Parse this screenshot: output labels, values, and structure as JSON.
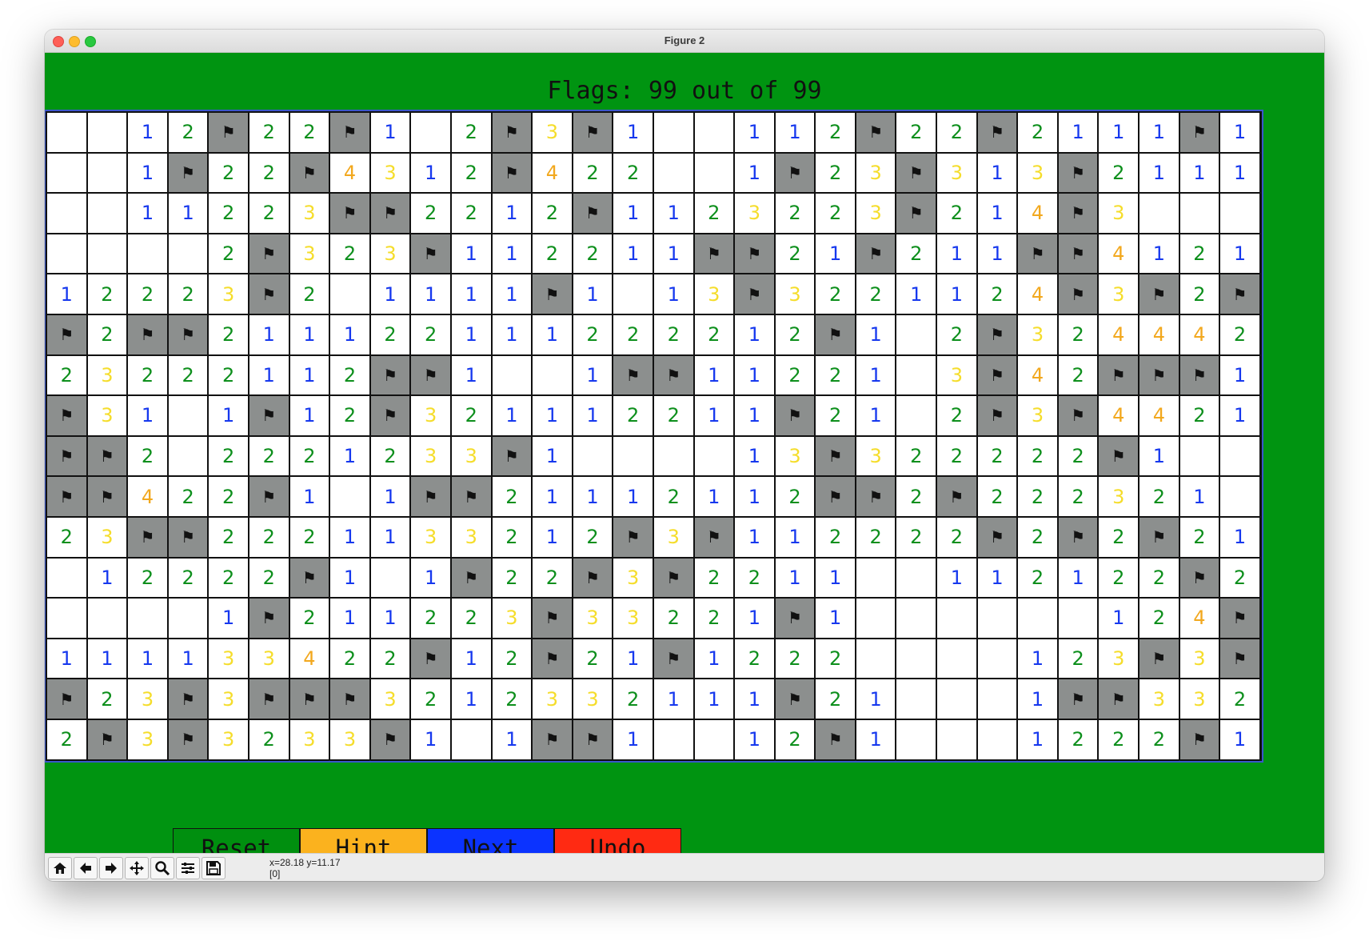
{
  "window": {
    "title": "Figure 2"
  },
  "header": {
    "flags_text": "Flags: 99 out of 99"
  },
  "board": {
    "rows": 16,
    "cols": 30,
    "cells": [
      [
        "",
        "",
        "1",
        "2",
        "F",
        "2",
        "2",
        "F",
        "1",
        "",
        "2",
        "F",
        "3",
        "F",
        "1",
        "",
        "",
        "1",
        "1",
        "2",
        "F",
        "2",
        "2",
        "F",
        "2",
        "1",
        "1",
        "1",
        "F",
        "1"
      ],
      [
        "",
        "",
        "1",
        "F",
        "2",
        "2",
        "F",
        "4",
        "3",
        "1",
        "2",
        "F",
        "4",
        "2",
        "2",
        "",
        "",
        "1",
        "F",
        "2",
        "3",
        "F",
        "3",
        "1",
        "3",
        "F",
        "2",
        "1",
        "1",
        "1"
      ],
      [
        "",
        "",
        "1",
        "1",
        "2",
        "2",
        "3",
        "F",
        "F",
        "2",
        "2",
        "1",
        "2",
        "F",
        "1",
        "1",
        "2",
        "3",
        "2",
        "2",
        "3",
        "F",
        "2",
        "1",
        "4",
        "F",
        "3",
        "",
        "",
        ""
      ],
      [
        "",
        "",
        "",
        "",
        "2",
        "F",
        "3",
        "2",
        "3",
        "F",
        "1",
        "1",
        "2",
        "2",
        "1",
        "1",
        "F",
        "F",
        "2",
        "1",
        "F",
        "2",
        "1",
        "1",
        "F",
        "F",
        "4",
        "1",
        "2",
        "1"
      ],
      [
        "1",
        "2",
        "2",
        "2",
        "3",
        "F",
        "2",
        "",
        "1",
        "1",
        "1",
        "1",
        "F",
        "1",
        "",
        "1",
        "3",
        "F",
        "3",
        "2",
        "2",
        "1",
        "1",
        "2",
        "4",
        "F",
        "3",
        "F",
        "2",
        "F"
      ],
      [
        "F",
        "2",
        "F",
        "F",
        "2",
        "1",
        "1",
        "1",
        "2",
        "2",
        "1",
        "1",
        "1",
        "2",
        "2",
        "2",
        "2",
        "1",
        "2",
        "F",
        "1",
        "",
        "2",
        "F",
        "3",
        "2",
        "4",
        "4",
        "4",
        "2"
      ],
      [
        "2",
        "3",
        "2",
        "2",
        "2",
        "1",
        "1",
        "2",
        "F",
        "F",
        "1",
        "",
        "",
        "1",
        "F",
        "F",
        "1",
        "1",
        "2",
        "2",
        "1",
        "",
        "3",
        "F",
        "4",
        "2",
        "F",
        "F",
        "F",
        "1"
      ],
      [
        "F",
        "3",
        "1",
        "",
        "1",
        "F",
        "1",
        "2",
        "F",
        "3",
        "2",
        "1",
        "1",
        "1",
        "2",
        "2",
        "1",
        "1",
        "F",
        "2",
        "1",
        "",
        "2",
        "F",
        "3",
        "F",
        "4",
        "4",
        "2",
        "1"
      ],
      [
        "F",
        "F",
        "2",
        "",
        "2",
        "2",
        "2",
        "1",
        "2",
        "3",
        "3",
        "F",
        "1",
        "",
        "",
        "",
        "",
        "1",
        "3",
        "F",
        "3",
        "2",
        "2",
        "2",
        "2",
        "2",
        "F",
        "1",
        "",
        ""
      ],
      [
        "F",
        "F",
        "4",
        "2",
        "2",
        "F",
        "1",
        "",
        "1",
        "F",
        "F",
        "2",
        "1",
        "1",
        "1",
        "2",
        "1",
        "1",
        "2",
        "F",
        "F",
        "2",
        "F",
        "2",
        "2",
        "2",
        "3",
        "2",
        "1",
        ""
      ],
      [
        "2",
        "3",
        "F",
        "F",
        "2",
        "2",
        "2",
        "1",
        "1",
        "3",
        "3",
        "2",
        "1",
        "2",
        "F",
        "3",
        "F",
        "1",
        "1",
        "2",
        "2",
        "2",
        "2",
        "F",
        "2",
        "F",
        "2",
        "F",
        "2",
        "1"
      ],
      [
        "",
        "1",
        "2",
        "2",
        "2",
        "2",
        "F",
        "1",
        "",
        "1",
        "F",
        "2",
        "2",
        "F",
        "3",
        "F",
        "2",
        "2",
        "1",
        "1",
        "",
        "",
        "1",
        "1",
        "2",
        "1",
        "2",
        "2",
        "F",
        "2"
      ],
      [
        "",
        "",
        "",
        "",
        "1",
        "F",
        "2",
        "1",
        "1",
        "2",
        "2",
        "3",
        "F",
        "3",
        "3",
        "2",
        "2",
        "1",
        "F",
        "1",
        "",
        "",
        "",
        "",
        "",
        "",
        "1",
        "2",
        "4",
        "F"
      ],
      [
        "1",
        "1",
        "1",
        "1",
        "3",
        "3",
        "4",
        "2",
        "2",
        "F",
        "1",
        "2",
        "F",
        "2",
        "1",
        "F",
        "1",
        "2",
        "2",
        "2",
        "",
        "",
        "",
        "",
        "1",
        "2",
        "3",
        "F",
        "3",
        "F"
      ],
      [
        "F",
        "2",
        "3",
        "F",
        "3",
        "F",
        "F",
        "F",
        "3",
        "2",
        "1",
        "2",
        "3",
        "3",
        "2",
        "1",
        "1",
        "1",
        "F",
        "2",
        "1",
        "",
        "",
        "",
        "1",
        "F",
        "F",
        "3",
        "3",
        "2"
      ],
      [
        "2",
        "F",
        "3",
        "F",
        "3",
        "2",
        "3",
        "3",
        "F",
        "1",
        "",
        "1",
        "F",
        "F",
        "1",
        "",
        "",
        "1",
        "2",
        "F",
        "1",
        "",
        "",
        "",
        "1",
        "2",
        "2",
        "2",
        "F",
        "1"
      ]
    ]
  },
  "buttons": [
    {
      "label": "Reset",
      "color": "#008f0f"
    },
    {
      "label": "Hint",
      "color": "#fbb21e"
    },
    {
      "label": "Next",
      "color": "#0b33ff"
    },
    {
      "label": "Undo",
      "color": "#ff2a12"
    }
  ],
  "toolbar": {
    "tools": [
      "home-icon",
      "back-arrow-icon",
      "forward-arrow-icon",
      "pan-icon",
      "zoom-icon",
      "configure-subplots-icon",
      "save-icon"
    ],
    "coord_line1": "x=28.18 y=11.17",
    "coord_line2": "[0]"
  },
  "colors": {
    "background": "#009411",
    "flag_cell": "#8c8f8e",
    "num1": "#1638ee",
    "num2": "#0d8f1c",
    "num3": "#f5dd2b",
    "num4": "#f2a81e"
  }
}
